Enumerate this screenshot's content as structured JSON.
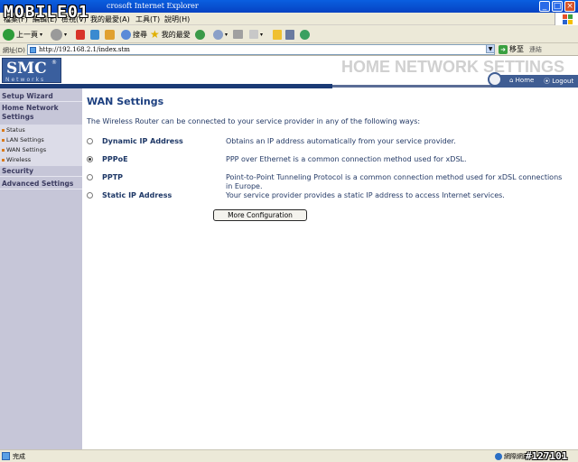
{
  "browser": {
    "window_title": "crosoft Internet Explorer",
    "menu": [
      "檔案(F)",
      "編輯(E)",
      "檢視(V)",
      "我的最愛(A)",
      "工具(T)",
      "說明(H)"
    ],
    "toolbar": {
      "back": "上一頁",
      "search": "搜尋",
      "favorites": "我的最愛"
    },
    "address_label": "網址(D)",
    "address_url": "http://192.168.2.1/index.stm",
    "go_label": "移至",
    "links_label": "連結",
    "status_text": "完成",
    "zone_text": "網際網路"
  },
  "watermark": {
    "text": "MOBILE01",
    "image_id": "#127101"
  },
  "header": {
    "logo": "SMC",
    "logo_reg": "®",
    "logo_sub": "Networks",
    "banner": "HOME NETWORK SETTINGS",
    "home_link": "Home",
    "logout_link": "Logout"
  },
  "sidebar": {
    "setup_wizard": "Setup Wizard",
    "home_network": "Home Network Settings",
    "items": [
      "Status",
      "LAN Settings",
      "WAN Settings",
      "Wireless"
    ],
    "security": "Security",
    "advanced": "Advanced Settings"
  },
  "main": {
    "title": "WAN Settings",
    "intro": "The Wireless Router can be connected to your service provider in any of the following ways:",
    "options": [
      {
        "name": "Dynamic IP Address",
        "desc": "Obtains an IP address automatically from your service provider.",
        "selected": false
      },
      {
        "name": "PPPoE",
        "desc": "PPP over Ethernet is a common connection method used for xDSL.",
        "selected": true
      },
      {
        "name": "PPTP",
        "desc": "Point-to-Point Tunneling Protocol is a common connection method used for xDSL connections in Europe.",
        "selected": false
      },
      {
        "name": "Static IP Address",
        "desc": "Your service provider provides a static IP address to access Internet services.",
        "selected": false
      }
    ],
    "button": "More Configuration"
  }
}
